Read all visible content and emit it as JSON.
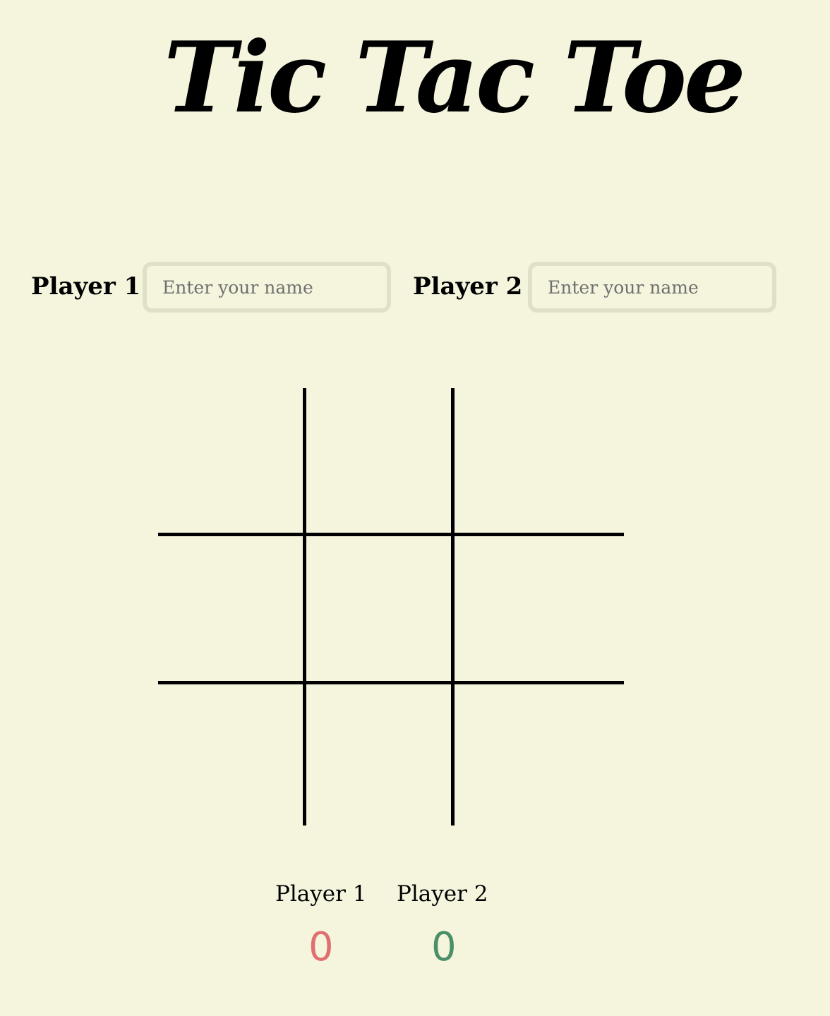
{
  "title": "Tic Tac Toe",
  "players": [
    {
      "label": "Player 1",
      "name_value": "",
      "name_placeholder": "Enter your name"
    },
    {
      "label": "Player 2",
      "name_value": "",
      "name_placeholder": "Enter your name"
    }
  ],
  "board": {
    "cells": [
      "",
      "",
      "",
      "",
      "",
      "",
      "",
      "",
      ""
    ]
  },
  "scoreboard": {
    "player1_label": "Player 1",
    "player2_label": "Player 2",
    "player1_score": "0",
    "player2_score": "0",
    "player1_color": "#e07070",
    "player2_color": "#4a8f68"
  }
}
